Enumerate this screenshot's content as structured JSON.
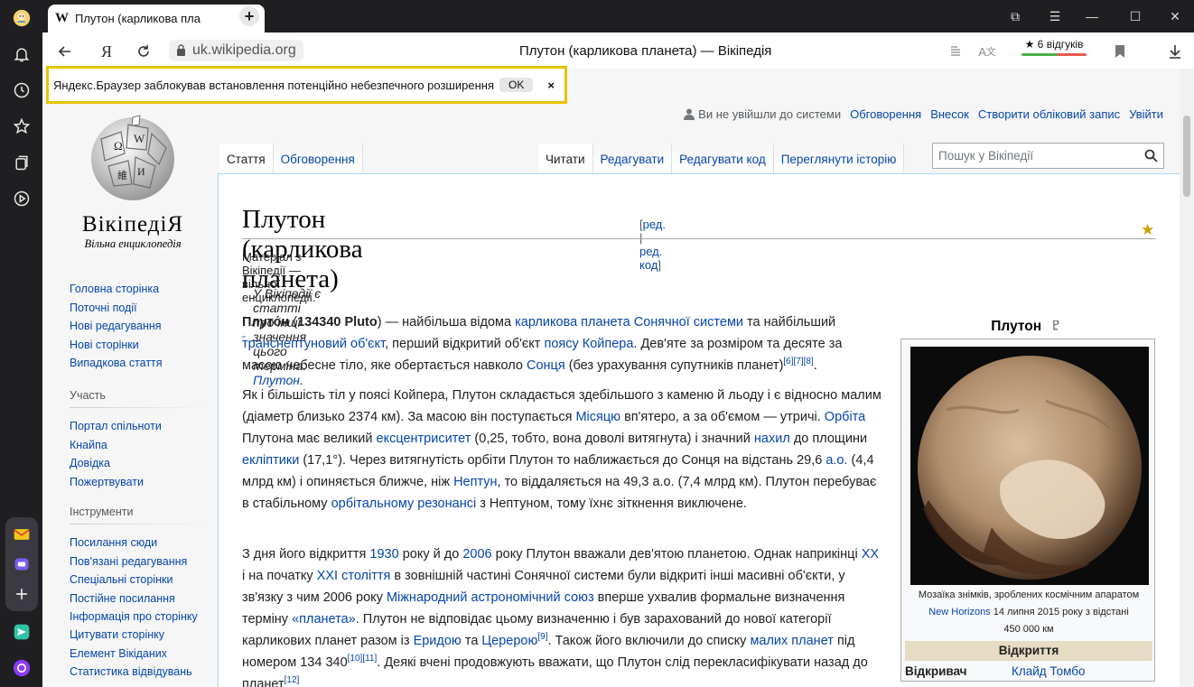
{
  "browser": {
    "tab_title": "Плутон (карликова пла",
    "tab_favicon": "W",
    "address": "uk.wikipedia.org",
    "page_title": "Плутон (карликова планета) — Вікіпедія",
    "reviews": "★ 6 відгуків"
  },
  "warning": {
    "text": "Яндекс.Браузер заблокував встановлення потенційно небезпечного розширення",
    "ok": "OK",
    "close": "×"
  },
  "wiki": {
    "personal": {
      "anon": "Ви не увійшли до системи",
      "talk": "Обговорення",
      "contrib": "Внесок",
      "create": "Створити обліковий запис",
      "login": "Увійти"
    },
    "logo": {
      "wordmark": "ВікіпедіЯ",
      "tagline": "Вільна енциклопедія"
    },
    "nav_main": [
      "Головна сторінка",
      "Поточні події",
      "Нові редагування",
      "Нові сторінки",
      "Випадкова стаття"
    ],
    "participate": {
      "heading": "Участь",
      "items": [
        "Портал спільноти",
        "Кнайпа",
        "Довідка",
        "Пожертвувати"
      ]
    },
    "tools": {
      "heading": "Інструменти",
      "items": [
        "Посилання сюди",
        "Пов'язані редагування",
        "Спеціальні сторінки",
        "Постійне посилання",
        "Інформація про сторінку",
        "Цитувати сторінку",
        "Елемент Вікіданих",
        "Статистика відвідувань"
      ]
    },
    "tabs_left": [
      "Стаття",
      "Обговорення"
    ],
    "tabs_right": [
      "Читати",
      "Редагувати",
      "Редагувати код",
      "Переглянути історію"
    ],
    "search_placeholder": "Пошук у Вікіпедії",
    "title": "Плутон (карликова планета)",
    "edit_links": {
      "edit": "ред.",
      "sep": "|",
      "code": "ред. код"
    },
    "from": "Матеріал з Вікіпедії — вільної енциклопедії.",
    "hatnote_text": "У Вікіпедії є статті про інші значення цього терміна:",
    "hatnote_link": "Плутон",
    "p1": {
      "a": "Плуто́н",
      "b": "134340 Pluto",
      "c": " — найбільша відома ",
      "l1": "карликова планета",
      "l2": "Сонячної системи",
      "d": " та найбільший ",
      "l3": "транснептуновий об'єкт",
      "e": ", перший відкритий об'єкт ",
      "l4": "поясу Койпера",
      "f": ". Дев'яте за розміром та десяте за масою небесне тіло, яке обертається навколо ",
      "l5": "Сонця",
      "g": " (без урахування супутників планет)",
      "refs": "[6][7][8]"
    },
    "p2": {
      "a": "Як і більшість тіл у поясі Койпера, Плутон складається здебільшого з каменю й льоду і є відносно малим (діаметр близько 2374 км). За масою він поступається ",
      "l1": "Місяцю",
      "b": " вп'ятеро, а за об'ємом — утричі. ",
      "l2": "Орбіта",
      "c": " Плутона має великий ",
      "l3": "ексцентриситет",
      "d": " (0,25, тобто, вона доволі витягнута) і значний ",
      "l4": "нахил",
      "e": " до площини ",
      "l5": "екліптики",
      "f": " (17,1°). Через витягнутість орбіти Плутон то наближається до Сонця на відстань 29,6 ",
      "l6": "а.о.",
      "g": " (4,4 млрд км) і опиняється ближче, ніж ",
      "l7": "Нептун",
      "h": ", то віддаляється на 49,3 а.о. (7,4 млрд км). Плутон перебуває в стабільному ",
      "l8": "орбітальному резонансі",
      "i": " з Нептуном, тому їхнє зіткнення виключене."
    },
    "p3": {
      "a": "З дня його відкриття ",
      "l1": "1930",
      "b": " року й до ",
      "l2": "2006",
      "c": " року Плутон вважали дев'ятою планетою. Однак наприкінці ",
      "l3": "XX",
      "d": " і на початку ",
      "l4": "XXI століття",
      "e": " в зовнішній частині Сонячної системи були відкриті інші масивні об'єкти, у зв'язку з чим 2006 року ",
      "l5": "Міжнародний астрономічний союз",
      "f": " вперше ухвалив формальне визначення терміну ",
      "l6": "«планета»",
      "g": ". Плутон не відповідає цьому визначенню і був зарахований до нової категорії карликових планет разом із ",
      "l7": "Еридою",
      "h": " та ",
      "l8": "Церерою",
      "r1": "[9]",
      "i": ". Також його включили до списку ",
      "l9": "малих планет",
      "j": " під номером 134 340",
      "r2": "[10][11]",
      "k": ". Деякі вчені продовжують вважати, що Плутон слід перекласифікувати назад до планет",
      "r3": "[12]"
    },
    "infobox": {
      "title": "Плутон",
      "symbol": "♇",
      "caption_a": "Мозаїка знімків, зроблених космічним апаратом",
      "caption_link": "New Horizons",
      "caption_b": "14 липня 2015 року з відстані",
      "caption_c": "450 000 км",
      "section": "Відкриття",
      "row_key": "Відкривач",
      "row_val": "Клайд Томбо"
    }
  }
}
